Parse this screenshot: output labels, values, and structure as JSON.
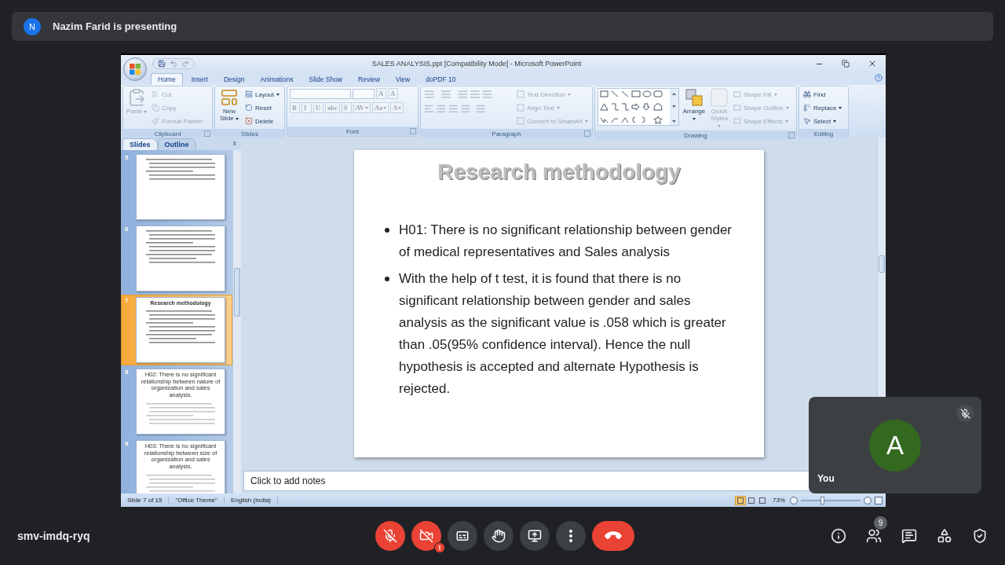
{
  "meet": {
    "presenter": {
      "initial": "N",
      "label": "Nazim Farid is presenting"
    },
    "meeting_code": "smv-imdq-ryq",
    "controls": [
      {
        "kind": "mic",
        "on": false
      },
      {
        "kind": "camera",
        "on": false,
        "alert": "!"
      },
      {
        "kind": "captions",
        "on": false
      },
      {
        "kind": "hand",
        "on": false
      },
      {
        "kind": "present",
        "on": false
      },
      {
        "kind": "more"
      },
      {
        "kind": "leave"
      }
    ],
    "side_buttons": [
      {
        "kind": "info"
      },
      {
        "kind": "people",
        "badge": "9"
      },
      {
        "kind": "chat"
      },
      {
        "kind": "activities"
      },
      {
        "kind": "host"
      }
    ],
    "self_tile": {
      "initial": "A",
      "name": "You",
      "muted": true
    }
  },
  "powerpoint": {
    "title": "SALES ANALYSIS.ppt [Compatibility Mode] - Microsoft PowerPoint",
    "tabs": [
      {
        "label": "Home",
        "selected": true
      },
      {
        "label": "Insert",
        "selected": false
      },
      {
        "label": "Design",
        "selected": false
      },
      {
        "label": "Animations",
        "selected": false
      },
      {
        "label": "Slide Show",
        "selected": false
      },
      {
        "label": "Review",
        "selected": false
      },
      {
        "label": "View",
        "selected": false
      },
      {
        "label": "doPDF 10",
        "selected": false
      }
    ],
    "ribbon": {
      "groups": [
        {
          "kind": "clipboard",
          "label": "Clipboard",
          "launcher": true,
          "items": [
            {
              "label": "Paste",
              "disabled": true,
              "dropdown": true
            },
            {
              "label": "Cut",
              "disabled": true,
              "dropdown": false
            },
            {
              "label": "Copy",
              "disabled": true,
              "dropdown": false
            },
            {
              "label": "Format Painter",
              "disabled": true,
              "dropdown": false
            }
          ]
        },
        {
          "kind": "slides",
          "label": "Slides",
          "launcher": false,
          "items": [
            {
              "label": "New Slide",
              "disabled": false,
              "dropdown": true
            },
            {
              "label": "Layout",
              "disabled": false,
              "dropdown": true
            },
            {
              "label": "Reset",
              "disabled": false,
              "dropdown": false
            },
            {
              "label": "Delete",
              "disabled": false,
              "dropdown": false
            }
          ]
        },
        {
          "kind": "font",
          "label": "Font",
          "launcher": true,
          "items": [
            {
              "label": "A",
              "disabled": true,
              "dropdown": false
            },
            {
              "label": "A",
              "disabled": true,
              "dropdown": false
            },
            {
              "label": "B",
              "disabled": true,
              "dropdown": false
            },
            {
              "label": "I",
              "disabled": true,
              "dropdown": false
            },
            {
              "label": "U",
              "disabled": true,
              "dropdown": false
            },
            {
              "label": "abc",
              "disabled": true,
              "dropdown": false
            },
            {
              "label": "S",
              "disabled": true,
              "dropdown": false
            },
            {
              "label": "AV",
              "disabled": true,
              "dropdown": true
            },
            {
              "label": "Aa",
              "disabled": true,
              "dropdown": true
            },
            {
              "label": "A",
              "disabled": true,
              "dropdown": true
            }
          ]
        },
        {
          "kind": "paragraph",
          "label": "Paragraph",
          "launcher": true,
          "items": [
            {
              "label": "Text Direction",
              "disabled": true,
              "dropdown": true
            },
            {
              "label": "Align Text",
              "disabled": true,
              "dropdown": true
            },
            {
              "label": "Convert to SmartArt",
              "disabled": true,
              "dropdown": true
            }
          ]
        },
        {
          "kind": "drawing",
          "label": "Drawing",
          "launcher": true,
          "items": [
            {
              "label": "Arrange",
              "disabled": false,
              "dropdown": true
            },
            {
              "label": "Quick Styles",
              "disabled": true,
              "dropdown": true
            },
            {
              "label": "Shape Fill",
              "disabled": true,
              "dropdown": true
            },
            {
              "label": "Shape Outline",
              "disabled": true,
              "dropdown": true
            },
            {
              "label": "Shape Effects",
              "disabled": true,
              "dropdown": true
            }
          ]
        },
        {
          "kind": "editing",
          "label": "Editing",
          "launcher": false,
          "items": [
            {
              "label": "Find",
              "disabled": false,
              "dropdown": false
            },
            {
              "label": "Replace",
              "disabled": false,
              "dropdown": true
            },
            {
              "label": "Select",
              "disabled": false,
              "dropdown": true
            }
          ]
        }
      ]
    },
    "panel": {
      "tabs": [
        {
          "label": "Slides",
          "selected": true
        },
        {
          "label": "Outline",
          "selected": false
        }
      ],
      "close": "x",
      "slides": [
        {
          "number": "5",
          "selected": false,
          "kind": "lines"
        },
        {
          "number": "6",
          "selected": false,
          "kind": "lines"
        },
        {
          "number": "7",
          "selected": true,
          "kind": "titled",
          "title": "Research methodology"
        },
        {
          "number": "8",
          "selected": false,
          "kind": "titled",
          "title": "H02: There is no significant relationship between nature of organization and sales analysis."
        },
        {
          "number": "9",
          "selected": false,
          "kind": "titled",
          "title": "H03: There is no significant relationship between size of organization and sales analysis."
        }
      ]
    },
    "slide": {
      "title": "Research methodology",
      "bullets": [
        "H01:  There is no significant relationship between gender of medical representatives and Sales analysis",
        "With the help of t test, it is found that there is no significant relationship between gender and sales analysis as the significant value is .058 which is greater than .05(95% confidence interval). Hence the null hypothesis is accepted and alternate Hypothesis is rejected."
      ]
    },
    "notes": {
      "placeholder": "Click to add notes"
    },
    "status": {
      "slide": "Slide 7 of 15",
      "theme": "\"Office Theme\"",
      "language": "English (India)",
      "views": [
        {
          "selected": true
        },
        {
          "selected": false
        },
        {
          "selected": false
        }
      ],
      "zoom": {
        "reading": "73%",
        "level": 0.37
      }
    }
  }
}
